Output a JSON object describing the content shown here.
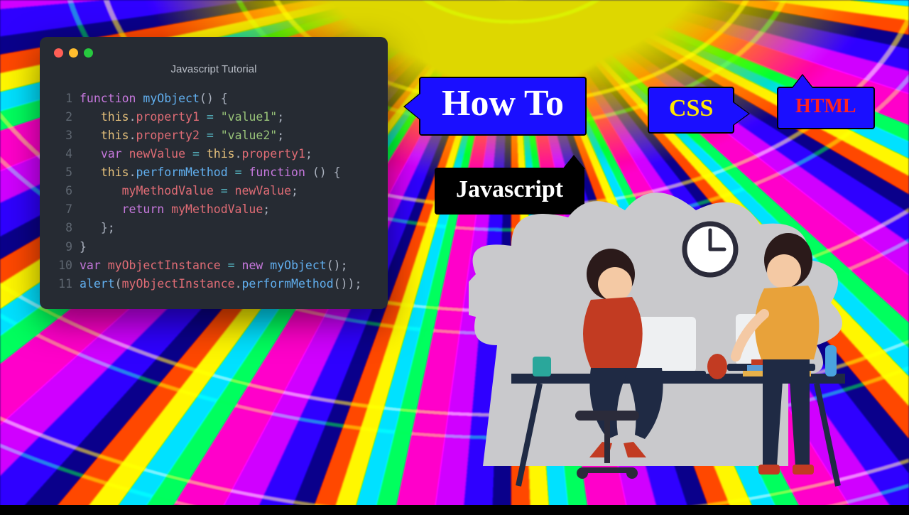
{
  "editor": {
    "title": "Javascript Tutorial",
    "lines": [
      {
        "n": "1",
        "tokens": [
          {
            "c": "kw",
            "t": "function "
          },
          {
            "c": "fn",
            "t": "myObject"
          },
          {
            "c": "paren",
            "t": "() {"
          }
        ]
      },
      {
        "n": "2",
        "tokens": [
          {
            "c": "plain",
            "t": "   "
          },
          {
            "c": "this",
            "t": "this"
          },
          {
            "c": "plain",
            "t": "."
          },
          {
            "c": "prop",
            "t": "property1"
          },
          {
            "c": "plain",
            "t": " "
          },
          {
            "c": "op",
            "t": "="
          },
          {
            "c": "plain",
            "t": " "
          },
          {
            "c": "str",
            "t": "\"value1\""
          },
          {
            "c": "plain",
            "t": ";"
          }
        ]
      },
      {
        "n": "3",
        "tokens": [
          {
            "c": "plain",
            "t": "   "
          },
          {
            "c": "this",
            "t": "this"
          },
          {
            "c": "plain",
            "t": "."
          },
          {
            "c": "prop",
            "t": "property2"
          },
          {
            "c": "plain",
            "t": " "
          },
          {
            "c": "op",
            "t": "="
          },
          {
            "c": "plain",
            "t": " "
          },
          {
            "c": "str",
            "t": "\"value2\""
          },
          {
            "c": "plain",
            "t": ";"
          }
        ]
      },
      {
        "n": "4",
        "tokens": [
          {
            "c": "plain",
            "t": "   "
          },
          {
            "c": "kw",
            "t": "var "
          },
          {
            "c": "prop",
            "t": "newValue"
          },
          {
            "c": "plain",
            "t": " "
          },
          {
            "c": "op",
            "t": "="
          },
          {
            "c": "plain",
            "t": " "
          },
          {
            "c": "this",
            "t": "this"
          },
          {
            "c": "plain",
            "t": "."
          },
          {
            "c": "prop",
            "t": "property1"
          },
          {
            "c": "plain",
            "t": ";"
          }
        ]
      },
      {
        "n": "5",
        "tokens": [
          {
            "c": "plain",
            "t": "   "
          },
          {
            "c": "this",
            "t": "this"
          },
          {
            "c": "plain",
            "t": "."
          },
          {
            "c": "fn",
            "t": "performMethod"
          },
          {
            "c": "plain",
            "t": " "
          },
          {
            "c": "op",
            "t": "="
          },
          {
            "c": "plain",
            "t": " "
          },
          {
            "c": "kw",
            "t": "function "
          },
          {
            "c": "paren",
            "t": "() {"
          }
        ]
      },
      {
        "n": "6",
        "tokens": [
          {
            "c": "plain",
            "t": "      "
          },
          {
            "c": "prop",
            "t": "myMethodValue"
          },
          {
            "c": "plain",
            "t": " "
          },
          {
            "c": "op",
            "t": "="
          },
          {
            "c": "plain",
            "t": " "
          },
          {
            "c": "prop",
            "t": "newValue"
          },
          {
            "c": "plain",
            "t": ";"
          }
        ]
      },
      {
        "n": "7",
        "tokens": [
          {
            "c": "plain",
            "t": "      "
          },
          {
            "c": "kw",
            "t": "return "
          },
          {
            "c": "prop",
            "t": "myMethodValue"
          },
          {
            "c": "plain",
            "t": ";"
          }
        ]
      },
      {
        "n": "8",
        "tokens": [
          {
            "c": "plain",
            "t": "   "
          },
          {
            "c": "paren",
            "t": "};"
          }
        ]
      },
      {
        "n": "9",
        "tokens": [
          {
            "c": "paren",
            "t": "}"
          }
        ]
      },
      {
        "n": "10",
        "tokens": [
          {
            "c": "kw",
            "t": "var "
          },
          {
            "c": "prop",
            "t": "myObjectInstance"
          },
          {
            "c": "plain",
            "t": " "
          },
          {
            "c": "op",
            "t": "="
          },
          {
            "c": "plain",
            "t": " "
          },
          {
            "c": "kw",
            "t": "new "
          },
          {
            "c": "fn",
            "t": "myObject"
          },
          {
            "c": "paren",
            "t": "();"
          }
        ]
      },
      {
        "n": "11",
        "tokens": [
          {
            "c": "fn",
            "t": "alert"
          },
          {
            "c": "paren",
            "t": "("
          },
          {
            "c": "prop",
            "t": "myObjectInstance"
          },
          {
            "c": "plain",
            "t": "."
          },
          {
            "c": "fn",
            "t": "performMethod"
          },
          {
            "c": "paren",
            "t": "());"
          }
        ]
      }
    ]
  },
  "labels": {
    "howto": "How To",
    "css": "CSS",
    "html": "HTML",
    "js": "Javascript"
  }
}
